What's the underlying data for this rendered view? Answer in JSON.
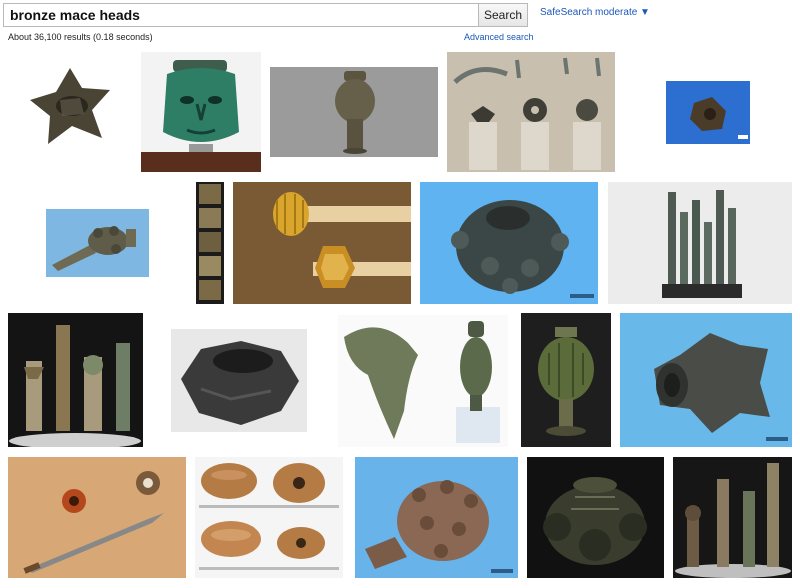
{
  "search": {
    "query": "bronze mace heads",
    "button_label": "Search",
    "safesearch_label": "SafeSearch moderate ▼",
    "result_count": "About 36,100 results (0.18 seconds)",
    "advanced_link": "Advanced search"
  },
  "colors": {
    "link": "#1a58b8",
    "bronze_dark": "#3b3a2c",
    "bronze_green": "#3d6b52",
    "sky_blue": "#6fb3e8"
  }
}
